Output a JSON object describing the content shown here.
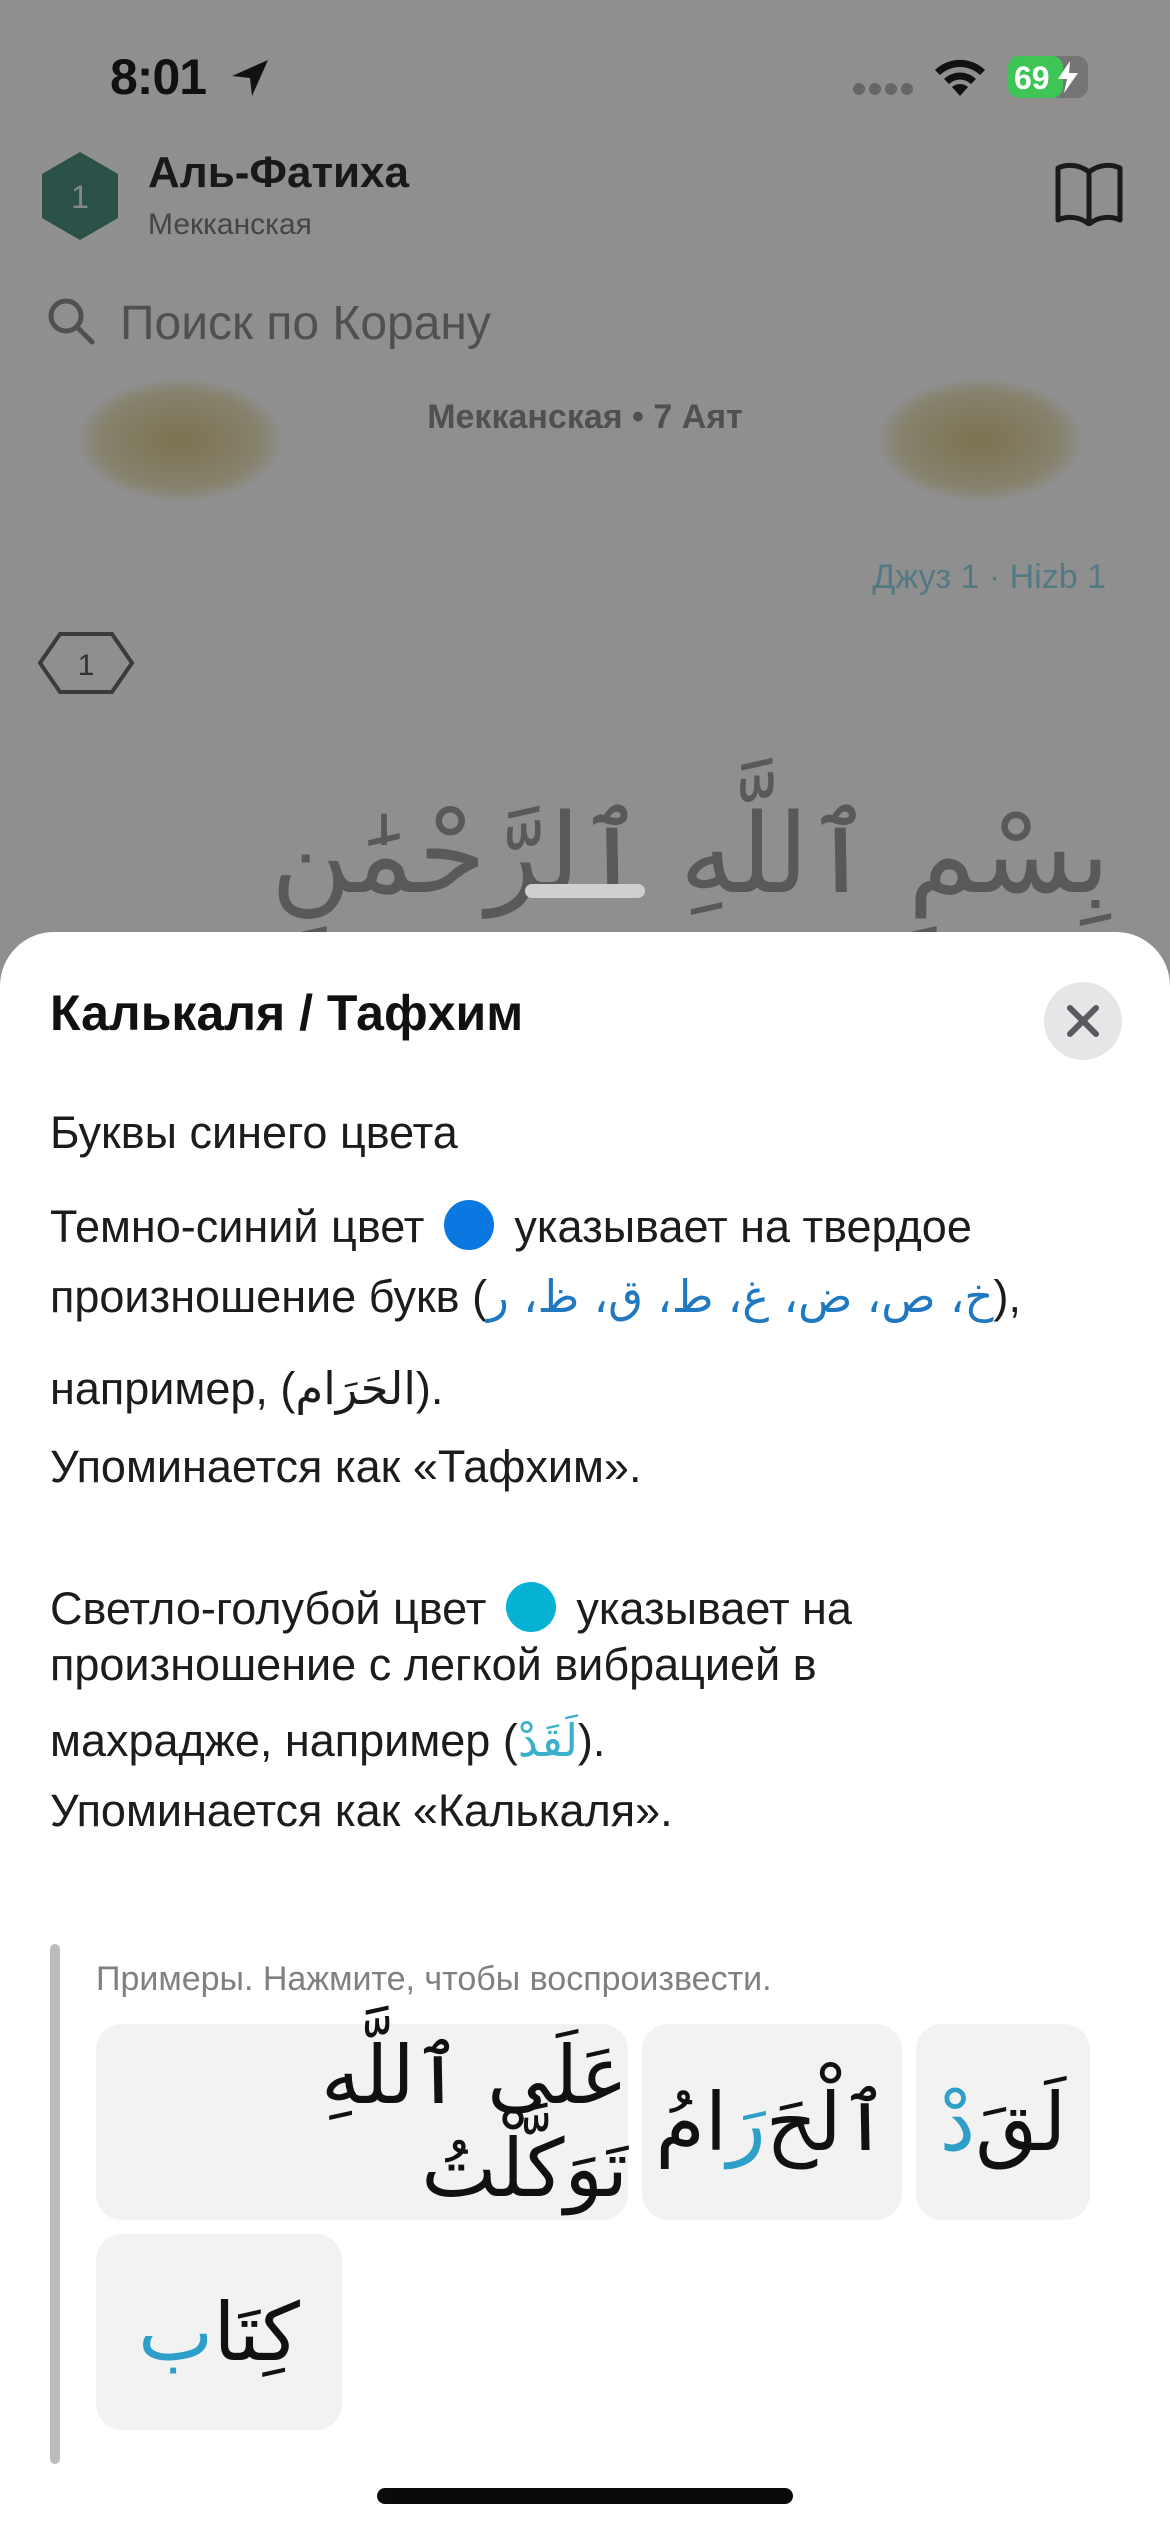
{
  "status_bar": {
    "time": "8:01",
    "battery": "69",
    "battery_level": 0.69
  },
  "background": {
    "juz_number": "1",
    "title": "Аль-Фатиха",
    "subtitle": "Мекканская",
    "search_placeholder": "Поиск по Корану",
    "meta": "Мекканская • 7 Аят",
    "juz_hizb": "Джуз 1 · Hizb 1",
    "ayah_number": "1",
    "bismillah": "بِسْمِ ٱللَّهِ ٱلرَّحْمَٰنِ ٱلرَّحِيمِ"
  },
  "sheet": {
    "title": "Калькаля / Тафхим",
    "subheading": "Буквы синего цвета",
    "p1_a": "Темно-синий цвет",
    "p1_b": "указывает на твердое",
    "p1_c": "произношение букв (",
    "p1_letters": "خ، ص، ض، غ، ط، ق، ظ، ر",
    "p1_d": "),",
    "p1_e": "например, (",
    "p1_example": "الحَرَام",
    "p1_f": ").",
    "p1_g": "Упоминается как «Тафхим».",
    "p2_a": "Светло-голубой цвет",
    "p2_b": "указывает на",
    "p2_c": "произношение с легкой вибрацией в",
    "p2_d": "махрадже, например (",
    "p2_example": "لَقَدْ",
    "p2_e": ").",
    "p2_f": "Упоминается как «Калькаля».",
    "examples_label": "Примеры. Нажмите, чтобы воспроизвести.",
    "examples": [
      {
        "before": "لَقَ",
        "highlight": "دْ",
        "after": ""
      },
      {
        "before": "ٱلْحَ",
        "highlight": "رَ",
        "after": "امُ"
      },
      {
        "before": "عَلَى ٱللَّهِ تَوَكَّلْتُ",
        "highlight": "",
        "after": ""
      },
      {
        "before": "كِتَا",
        "highlight": "ب",
        "after": ""
      }
    ]
  },
  "colors": {
    "dark_blue": "#0a78e0",
    "light_blue": "#06b2d4",
    "highlight_text": "#2d9fc8",
    "battery_green": "#3ec556"
  }
}
